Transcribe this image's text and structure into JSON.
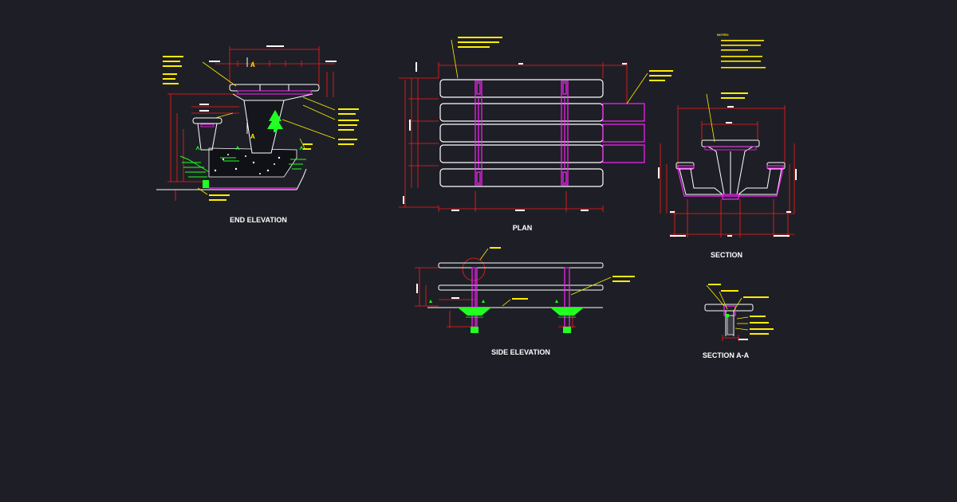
{
  "titles": {
    "end_elevation": "END ELEVATION",
    "plan": "PLAN",
    "section": "SECTION",
    "side_elevation": "SIDE ELEVATION",
    "section_aa": "SECTION A-A"
  },
  "notes_heading": "NOTES:",
  "section_marker": "A",
  "colors": {
    "background": "#1e1f26",
    "outline": "#ffffff",
    "dimension": "#ff1a1a",
    "frame": "#ff22ff",
    "leader": "#ffee00",
    "ground": "#22ff22"
  }
}
